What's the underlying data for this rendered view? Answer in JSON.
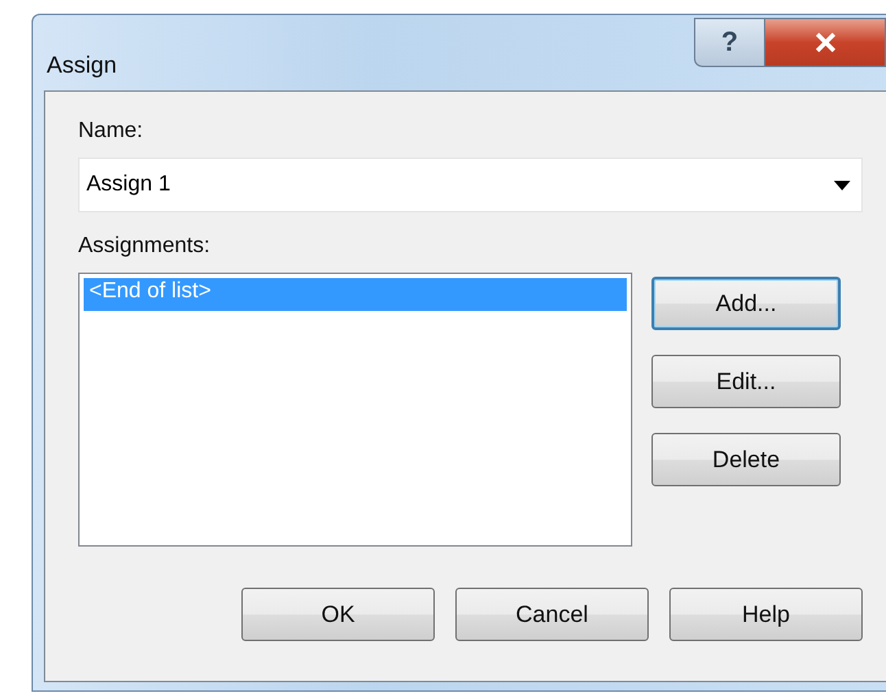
{
  "window": {
    "title": "Assign",
    "help_glyph": "?"
  },
  "name_field": {
    "label": "Name:",
    "value": "Assign 1"
  },
  "assignments": {
    "label": "Assignments:",
    "items": [
      {
        "text": "<End of list>",
        "selected": true
      }
    ]
  },
  "side_buttons": [
    {
      "label": "Add...",
      "default": true
    },
    {
      "label": "Edit...",
      "default": false
    },
    {
      "label": "Delete",
      "default": false
    }
  ],
  "buttons": [
    "OK",
    "Cancel",
    "Help"
  ]
}
